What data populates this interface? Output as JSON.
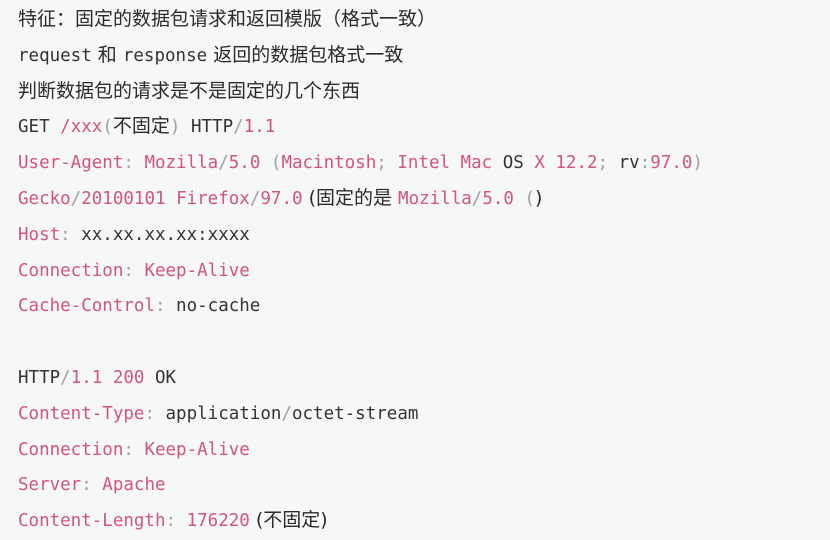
{
  "lines": [
    {
      "id": "feature",
      "segments": [
        {
          "t": "特征：固定的数据包请求和返回模版（格式一致）",
          "c": "cn"
        }
      ]
    },
    {
      "id": "rr",
      "segments": [
        {
          "t": "request",
          "c": "mono t"
        },
        {
          "t": " 和 ",
          "c": "cn"
        },
        {
          "t": "response",
          "c": "mono t"
        },
        {
          "t": " 返回的数据包格式一致",
          "c": "cn"
        }
      ]
    },
    {
      "id": "judge",
      "segments": [
        {
          "t": "判断数据包的请求是不是固定的几个东西",
          "c": "cn"
        }
      ]
    },
    {
      "id": "get",
      "segments": [
        {
          "t": "GET ",
          "c": "mono t"
        },
        {
          "t": "/xxx",
          "c": "mono k"
        },
        {
          "t": "(",
          "c": "mono p"
        },
        {
          "t": "不固定",
          "c": "cn"
        },
        {
          "t": ")",
          "c": "mono p"
        },
        {
          "t": " HTTP",
          "c": "mono t"
        },
        {
          "t": "/",
          "c": "mono p"
        },
        {
          "t": "1.1",
          "c": "mono k"
        }
      ]
    },
    {
      "id": "ua",
      "segments": [
        {
          "t": "User-Agent",
          "c": "mono k"
        },
        {
          "t": ": ",
          "c": "mono p"
        },
        {
          "t": "Mozilla",
          "c": "mono k"
        },
        {
          "t": "/",
          "c": "mono p"
        },
        {
          "t": "5.0",
          "c": "mono k"
        },
        {
          "t": " (",
          "c": "mono p"
        },
        {
          "t": "Macintosh",
          "c": "mono k"
        },
        {
          "t": "; ",
          "c": "mono p"
        },
        {
          "t": "Intel Mac",
          "c": "mono k"
        },
        {
          "t": " OS ",
          "c": "mono t"
        },
        {
          "t": "X 12.2",
          "c": "mono k"
        },
        {
          "t": "; ",
          "c": "mono p"
        },
        {
          "t": "rv",
          "c": "mono t"
        },
        {
          "t": ":",
          "c": "mono p"
        },
        {
          "t": "97.0",
          "c": "mono k"
        },
        {
          "t": ")",
          "c": "mono p"
        }
      ]
    },
    {
      "id": "gecko",
      "segments": [
        {
          "t": "Gecko",
          "c": "mono k"
        },
        {
          "t": "/",
          "c": "mono p"
        },
        {
          "t": "20100101",
          "c": "mono k"
        },
        {
          "t": " Firefox",
          "c": "mono k"
        },
        {
          "t": "/",
          "c": "mono p"
        },
        {
          "t": "97.0",
          "c": "mono k"
        },
        {
          "t": " (固定的是 ",
          "c": "cn"
        },
        {
          "t": "Mozilla",
          "c": "mono k"
        },
        {
          "t": "/",
          "c": "mono p"
        },
        {
          "t": "5.0",
          "c": "mono k"
        },
        {
          "t": " (",
          "c": "mono p"
        },
        {
          "t": ")",
          "c": "cn"
        }
      ]
    },
    {
      "id": "host",
      "segments": [
        {
          "t": "Host",
          "c": "mono k"
        },
        {
          "t": ": ",
          "c": "mono p"
        },
        {
          "t": "xx.xx.xx.xx:xxxx",
          "c": "mono t"
        }
      ]
    },
    {
      "id": "conn1",
      "segments": [
        {
          "t": "Connection",
          "c": "mono k"
        },
        {
          "t": ": ",
          "c": "mono p"
        },
        {
          "t": "Keep-Alive",
          "c": "mono k"
        }
      ]
    },
    {
      "id": "cache",
      "segments": [
        {
          "t": "Cache-Control",
          "c": "mono k"
        },
        {
          "t": ": ",
          "c": "mono p"
        },
        {
          "t": "no-cache",
          "c": "mono t"
        }
      ]
    },
    {
      "id": "blank",
      "segments": []
    },
    {
      "id": "status",
      "segments": [
        {
          "t": "HTTP",
          "c": "mono t"
        },
        {
          "t": "/",
          "c": "mono p"
        },
        {
          "t": "1.1",
          "c": "mono k"
        },
        {
          "t": " ",
          "c": "mono t"
        },
        {
          "t": "200",
          "c": "mono k"
        },
        {
          "t": " OK",
          "c": "mono t"
        }
      ]
    },
    {
      "id": "ctype",
      "segments": [
        {
          "t": "Content-Type",
          "c": "mono k"
        },
        {
          "t": ": ",
          "c": "mono p"
        },
        {
          "t": "application",
          "c": "mono t"
        },
        {
          "t": "/",
          "c": "mono p"
        },
        {
          "t": "octet-stream",
          "c": "mono t"
        }
      ]
    },
    {
      "id": "conn2",
      "segments": [
        {
          "t": "Connection",
          "c": "mono k"
        },
        {
          "t": ": ",
          "c": "mono p"
        },
        {
          "t": "Keep-Alive",
          "c": "mono k"
        }
      ]
    },
    {
      "id": "server",
      "segments": [
        {
          "t": "Server",
          "c": "mono k"
        },
        {
          "t": ": ",
          "c": "mono p"
        },
        {
          "t": "Apache",
          "c": "mono k"
        }
      ]
    },
    {
      "id": "clen",
      "segments": [
        {
          "t": "Content-Length",
          "c": "mono k"
        },
        {
          "t": ": ",
          "c": "mono p"
        },
        {
          "t": "176220",
          "c": "mono k"
        },
        {
          "t": " (不固定)",
          "c": "cn"
        }
      ]
    }
  ]
}
